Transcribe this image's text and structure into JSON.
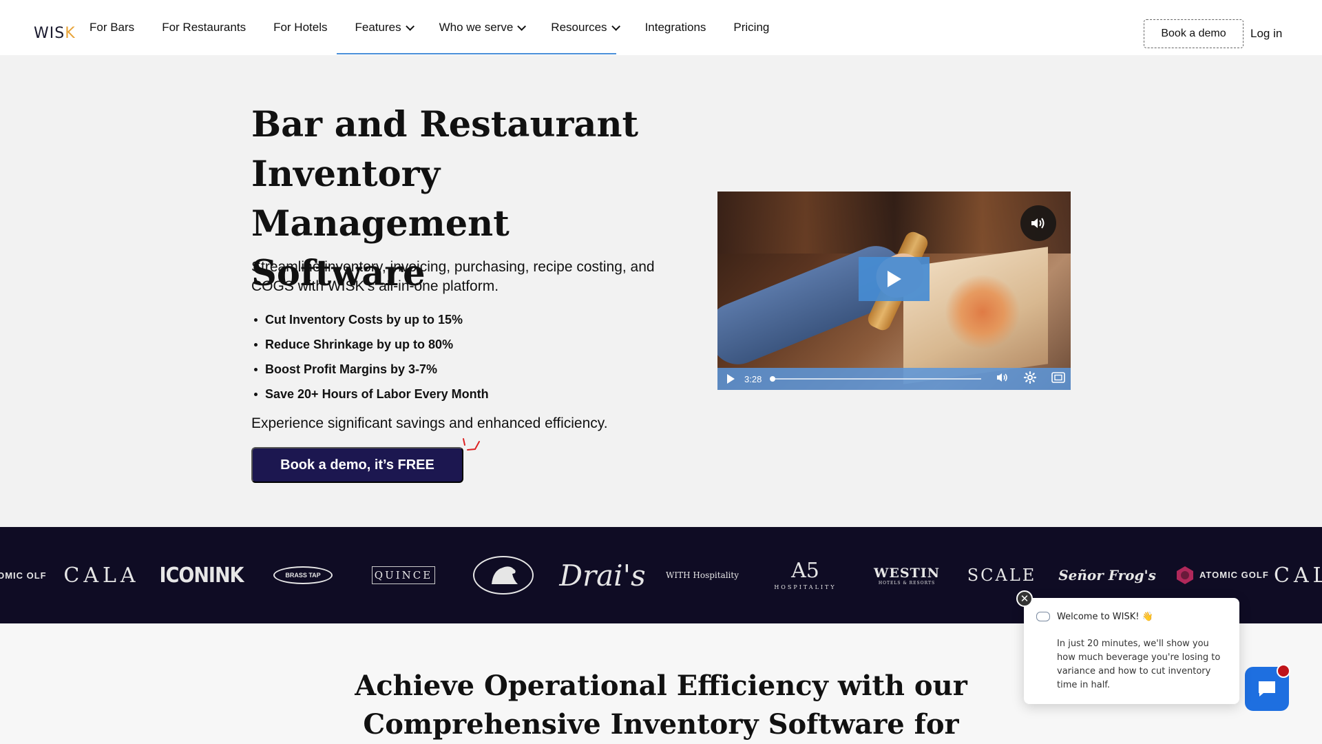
{
  "header": {
    "logo": {
      "main": "WIS",
      "accent": "K"
    },
    "nav": [
      {
        "label": "For Bars",
        "dropdown": false
      },
      {
        "label": "For Restaurants",
        "dropdown": false
      },
      {
        "label": "For Hotels",
        "dropdown": false
      },
      {
        "label": "Features",
        "dropdown": true
      },
      {
        "label": "Who we serve",
        "dropdown": true
      },
      {
        "label": "Resources",
        "dropdown": true
      },
      {
        "label": "Integrations",
        "dropdown": false
      },
      {
        "label": "Pricing",
        "dropdown": false
      }
    ],
    "book_demo": "Book a demo",
    "login": "Log in"
  },
  "hero": {
    "title": "Bar and Restaurant Inventory Management Software",
    "subtitle": "Streamline inventory, invoicing, purchasing, recipe costing, and COGS with WISK’s all-in-one platform.",
    "bullets": [
      "Cut Inventory Costs by up to 15%",
      "Reduce Shrinkage by up to 80%",
      "Boost Profit Margins by 3-7%",
      "Save 20+ Hours of Labor Every Month"
    ],
    "note": "Experience significant savings and enhanced efficiency.",
    "cta": "Book a demo, it’s FREE"
  },
  "video": {
    "duration": "3:28",
    "accent_color": "#4a8fdc"
  },
  "logos": [
    "TOMIC OLF",
    "CALA",
    "ICONINK",
    "BRASS TAP",
    "QUINCE",
    "DOG",
    "Drai's",
    "WITH Hospitality",
    "A5",
    "HOSPITALITY",
    "WESTIN",
    "HOTELS & RESORTS",
    "SCALE",
    "Señor Frog's",
    "ATOMIC GOLF",
    "CAL"
  ],
  "section": {
    "title": "Achieve Operational Efficiency with our Comprehensive Inventory Software for"
  },
  "chat": {
    "welcome": "Welcome to WISK! 👋",
    "message": "In just 20 minutes, we'll show you how much beverage you're losing to variance and how to cut inventory time in half."
  },
  "colors": {
    "brand_navy": "#1c1750",
    "strip_bg": "#0f0c24",
    "chat_blue": "#1e6fe0",
    "logo_accent": "#e8a43a"
  }
}
